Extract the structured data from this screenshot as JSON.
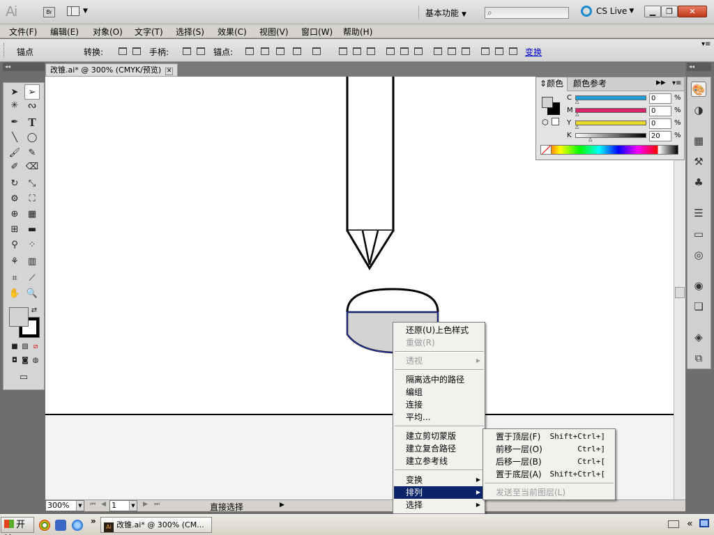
{
  "app": {
    "logo": "Ai",
    "bridge": "Br",
    "workspace": "基本功能",
    "cslive": "CS Live",
    "window_buttons": [
      "minimize",
      "maximize",
      "close"
    ]
  },
  "menubar": [
    "文件(F)",
    "编辑(E)",
    "对象(O)",
    "文字(T)",
    "选择(S)",
    "效果(C)",
    "视图(V)",
    "窗口(W)",
    "帮助(H)"
  ],
  "control_bar": {
    "anchor_label": "锚点",
    "convert_label": "转换:",
    "handles_label": "手柄:",
    "anchors_label": "锚点:",
    "transform_link": "变换"
  },
  "document": {
    "tab_title": "改锥.ai* @ 300% (CMYK/预览)",
    "zoom": "300%",
    "page": "1",
    "status_text": "直接选择"
  },
  "color_panel": {
    "tabs": [
      "颜色",
      "颜色参考"
    ],
    "channels": [
      {
        "label": "C",
        "value": "0",
        "unit": "%",
        "color": "#1e9fd8"
      },
      {
        "label": "M",
        "value": "0",
        "unit": "%",
        "color": "#d6256f"
      },
      {
        "label": "Y",
        "value": "0",
        "unit": "%",
        "color": "#e8d82a"
      },
      {
        "label": "K",
        "value": "20",
        "unit": "%",
        "color": "#333333"
      }
    ]
  },
  "context_menu": {
    "items": [
      {
        "label": "还原(U)上色样式",
        "state": "normal"
      },
      {
        "label": "重做(R)",
        "state": "disabled"
      },
      {
        "label": "透视",
        "state": "disabled",
        "submenu": true
      },
      {
        "label": "隔离选中的路径",
        "state": "normal"
      },
      {
        "label": "编组",
        "state": "normal"
      },
      {
        "label": "连接",
        "state": "normal"
      },
      {
        "label": "平均...",
        "state": "normal"
      },
      {
        "label": "建立剪切蒙版",
        "state": "normal"
      },
      {
        "label": "建立复合路径",
        "state": "normal"
      },
      {
        "label": "建立参考线",
        "state": "normal"
      },
      {
        "label": "变换",
        "state": "normal",
        "submenu": true
      },
      {
        "label": "排列",
        "state": "highlighted",
        "submenu": true
      },
      {
        "label": "选择",
        "state": "normal",
        "submenu": true
      }
    ]
  },
  "arrange_submenu": {
    "items": [
      {
        "label": "置于顶层(F)",
        "shortcut": "Shift+Ctrl+]",
        "state": "normal"
      },
      {
        "label": "前移一层(O)",
        "shortcut": "Ctrl+]",
        "state": "normal"
      },
      {
        "label": "后移一层(B)",
        "shortcut": "Ctrl+[",
        "state": "normal"
      },
      {
        "label": "置于底层(A)",
        "shortcut": "Shift+Ctrl+[",
        "state": "normal"
      },
      {
        "label": "发送至当前图层(L)",
        "shortcut": "",
        "state": "disabled"
      }
    ]
  },
  "taskbar": {
    "start": "开始",
    "task_window": "改锥.ai* @ 300% (CM..."
  },
  "colors": {
    "selection_blue": "#2a3fbf",
    "menu_highlight": "#0a246a",
    "fill_gray": "#d3d3d3"
  }
}
